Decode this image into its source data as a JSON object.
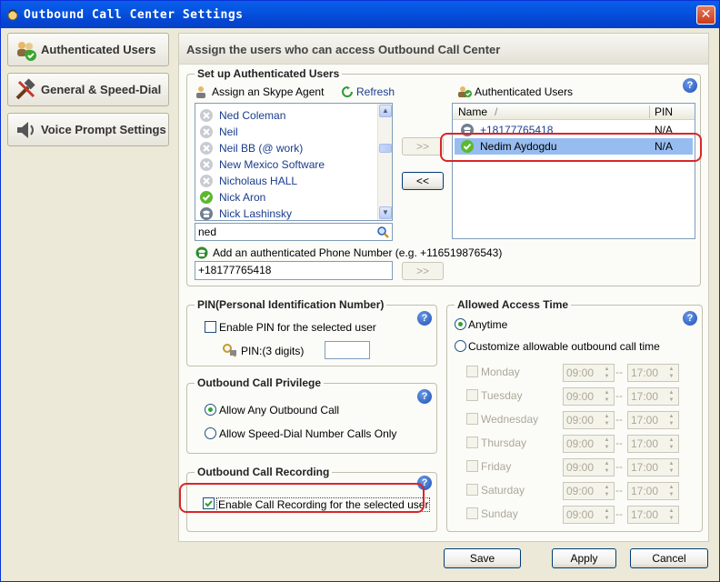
{
  "window": {
    "title": "Outbound Call Center Settings",
    "close_glyph": "✕"
  },
  "nav": [
    {
      "label": "Authenticated Users",
      "icon": "users-icon"
    },
    {
      "label": "General & Speed-Dial",
      "icon": "tools-icon"
    },
    {
      "label": "Voice Prompt Settings",
      "icon": "speaker-icon"
    }
  ],
  "panel": {
    "header": "Assign the users who can access Outbound Call Center"
  },
  "setup": {
    "title": "Set up Authenticated Users",
    "assign_label": "Assign an Skype Agent",
    "refresh_label": "Refresh",
    "contacts": [
      {
        "name": "Ned Coleman",
        "status": "offline"
      },
      {
        "name": "Neil",
        "status": "offline"
      },
      {
        "name": "Neil BB (@ work)",
        "status": "offline"
      },
      {
        "name": "New Mexico Software",
        "status": "offline"
      },
      {
        "name": "Nicholaus HALL",
        "status": "offline"
      },
      {
        "name": "Nick Aron",
        "status": "online"
      },
      {
        "name": "Nick Lashinsky",
        "status": "phone"
      }
    ],
    "search_value": "ned",
    "add_button": ">>",
    "remove_button": "<<",
    "authenticated_label": "Authenticated Users",
    "columns": {
      "name": "Name",
      "sort_glyph": "/",
      "pin": "PIN"
    },
    "users": [
      {
        "name": "+18177765418",
        "pin": "N/A",
        "status": "phone",
        "selected": false
      },
      {
        "name": "Nedim Aydogdu",
        "pin": "N/A",
        "status": "online",
        "selected": true
      }
    ],
    "phone_label": "Add an authenticated Phone Number (e.g. +116519876543)",
    "phone_value": "+18177765418",
    "phone_add_button": ">>"
  },
  "pin": {
    "title": "PIN(Personal Identification Number)",
    "enable_label": "Enable PIN for the selected user",
    "enabled": false,
    "pin_label": "PIN:(3 digits)",
    "pin_value": ""
  },
  "privilege": {
    "title": "Outbound Call Privilege",
    "options": [
      "Allow Any Outbound Call",
      "Allow Speed-Dial Number Calls Only"
    ],
    "selected": 0
  },
  "recording": {
    "title": "Outbound Call Recording",
    "enable_label": "Enable Call Recording for the selected user",
    "enabled": true
  },
  "access": {
    "title": "Allowed Access Time",
    "anytime_label": "Anytime",
    "custom_label": "Customize allowable outbound call time",
    "selected": "anytime",
    "days": [
      {
        "day": "Monday",
        "from": "09:00",
        "to": "17:00"
      },
      {
        "day": "Tuesday",
        "from": "09:00",
        "to": "17:00"
      },
      {
        "day": "Wednesday",
        "from": "09:00",
        "to": "17:00"
      },
      {
        "day": "Thursday",
        "from": "09:00",
        "to": "17:00"
      },
      {
        "day": "Friday",
        "from": "09:00",
        "to": "17:00"
      },
      {
        "day": "Saturday",
        "from": "09:00",
        "to": "17:00"
      },
      {
        "day": "Sunday",
        "from": "09:00",
        "to": "17:00"
      }
    ],
    "separator": "--"
  },
  "footer": {
    "save": "Save",
    "apply": "Apply",
    "cancel": "Cancel"
  },
  "help_glyph": "?",
  "colors": {
    "title_bar": "#0553e0",
    "selection": "#97bdf0",
    "highlight_ring": "#d9262a",
    "online": "#5bb82f"
  }
}
